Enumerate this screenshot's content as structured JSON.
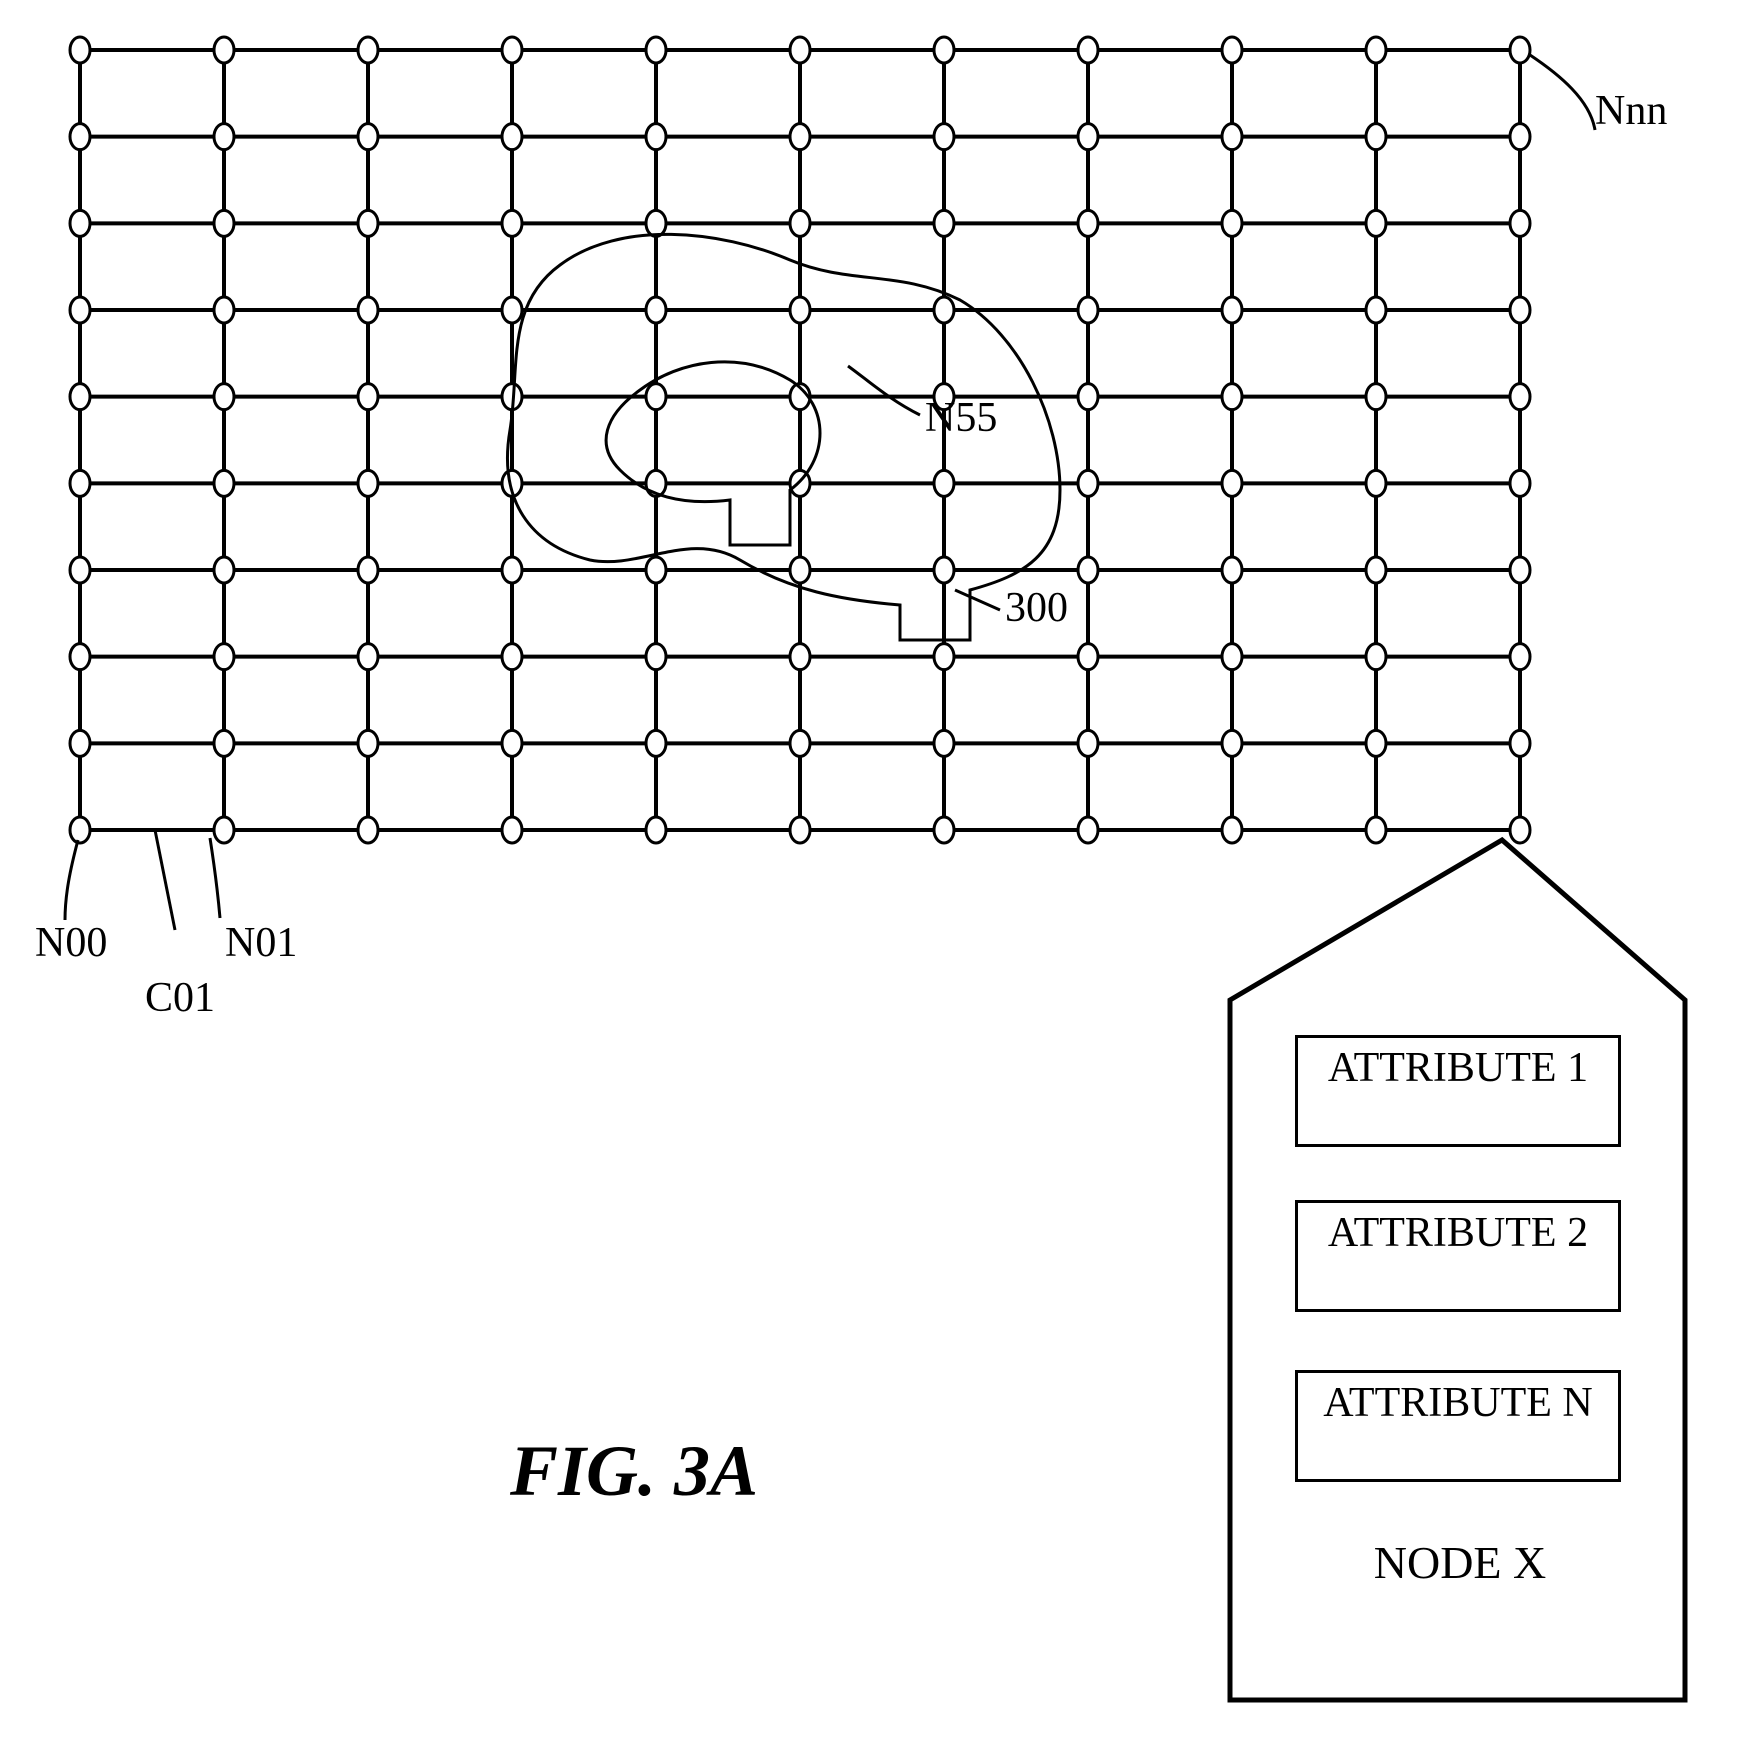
{
  "figure": {
    "title": "FIG. 3A",
    "grid_cols": 11,
    "grid_rows": 10,
    "labels": {
      "top_right": "Nnn",
      "center_node": "N55",
      "center_region": "300",
      "bottom_left_node0": "N00",
      "bottom_left_node1": "N01",
      "bottom_left_conn": "C01"
    },
    "callout": {
      "attributes": [
        "ATTRIBUTE\n1",
        "ATTRIBUTE\n2",
        "ATTRIBUTE\nN"
      ],
      "title": "NODE\nX"
    }
  }
}
